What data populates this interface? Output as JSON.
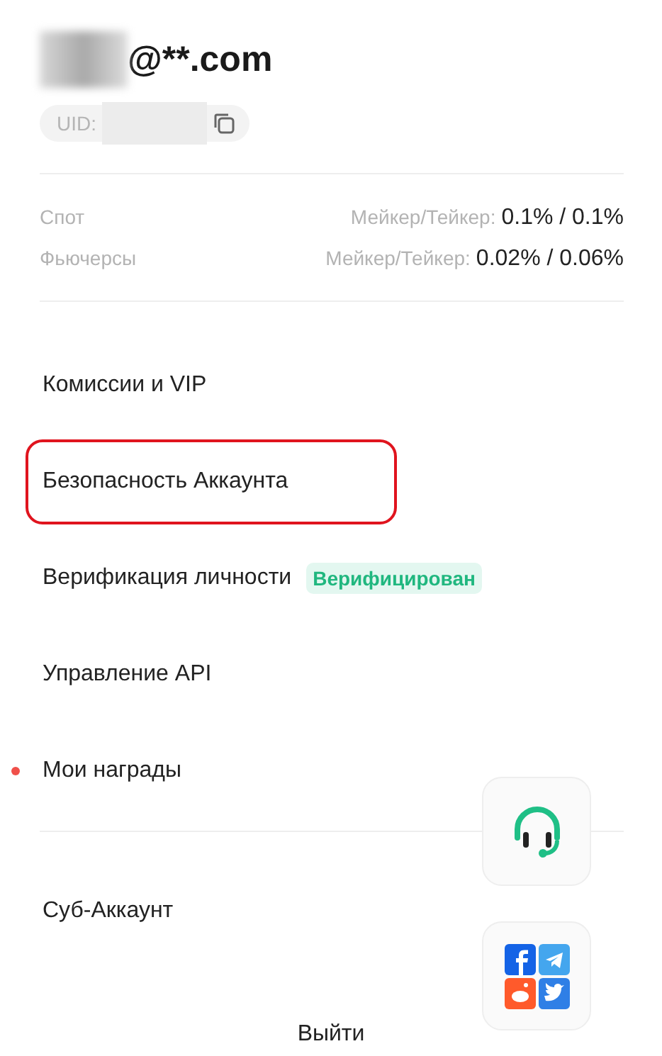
{
  "account": {
    "email": "@**.com",
    "uid_label": "UID:"
  },
  "fees": [
    {
      "market": "Спот",
      "label": "Мейкер/Тейкер:",
      "value": "0.1% / 0.1%"
    },
    {
      "market": "Фьючерсы",
      "label": "Мейкер/Тейкер:",
      "value": "0.02% / 0.06%"
    }
  ],
  "menu": [
    {
      "label": "Комиссии и VIP",
      "highlighted": false,
      "dot": false
    },
    {
      "label": "Безопасность Аккаунта",
      "highlighted": true,
      "dot": false
    },
    {
      "label": "Верификация личности",
      "highlighted": false,
      "dot": false,
      "badge": "Верифицирован"
    },
    {
      "label": "Управление API",
      "highlighted": false,
      "dot": false
    },
    {
      "label": "Мои награды",
      "highlighted": false,
      "dot": true
    },
    {
      "label": "Суб-Аккаунт",
      "highlighted": false,
      "dot": false,
      "divider_before": true
    }
  ],
  "logout": "Выйти"
}
